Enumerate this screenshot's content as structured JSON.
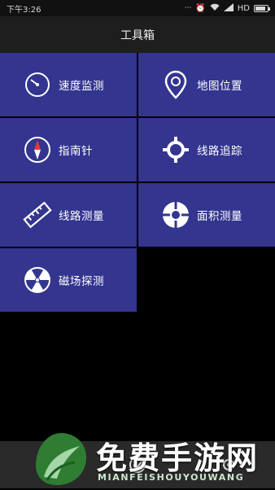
{
  "status": {
    "time": "下午3:26",
    "network": "HD"
  },
  "header": {
    "title": "工具箱"
  },
  "tools": [
    {
      "label": "速度监测",
      "icon": "speedometer-icon"
    },
    {
      "label": "地图位置",
      "icon": "map-pin-icon"
    },
    {
      "label": "指南针",
      "icon": "compass-icon"
    },
    {
      "label": "线路追踪",
      "icon": "crosshair-icon"
    },
    {
      "label": "线路测量",
      "icon": "ruler-icon"
    },
    {
      "label": "面积测量",
      "icon": "target-icon"
    },
    {
      "label": "磁场探测",
      "icon": "radiation-icon"
    }
  ],
  "watermark": {
    "title": "免费手游网",
    "subtitle": "MIANFEISHOUYOUWANG"
  },
  "colors": {
    "tile": "#33358f",
    "titlebar": "#1e1e1e",
    "background": "#000000"
  }
}
